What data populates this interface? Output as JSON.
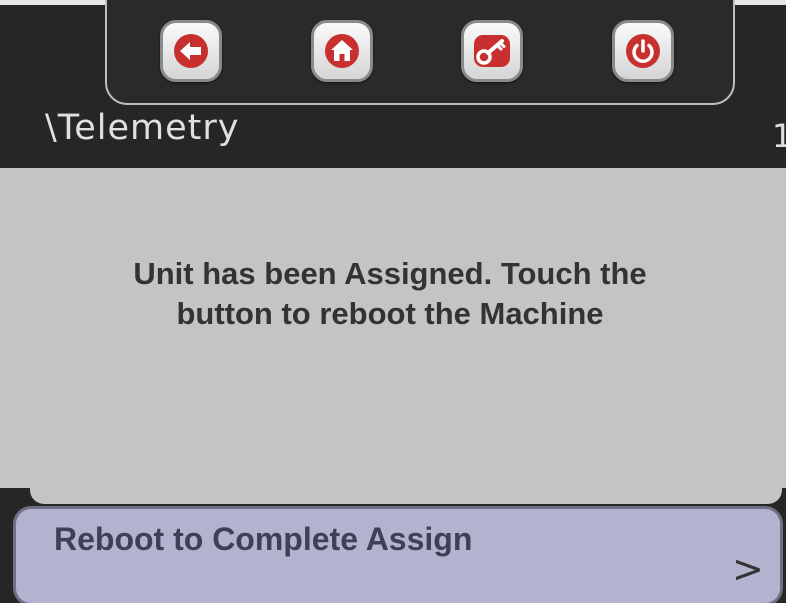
{
  "header": {
    "breadcrumb": "\\Telemetry",
    "page_number": "1"
  },
  "nav": {
    "buttons": [
      {
        "name": "back-button",
        "icon": "arrow-left-icon"
      },
      {
        "name": "home-button",
        "icon": "home-icon"
      },
      {
        "name": "key-button",
        "icon": "key-icon"
      },
      {
        "name": "power-button",
        "icon": "power-icon"
      }
    ]
  },
  "message": {
    "line1": "Unit has been Assigned. Touch the",
    "line2": "button to reboot the Machine"
  },
  "action": {
    "label": "Reboot to Complete Assign",
    "chevron": ">"
  },
  "colors": {
    "header_bg": "#262626",
    "panel_bg": "#c4c4c4",
    "action_bg": "#b3b3cf",
    "icon_red": "#c7302e"
  }
}
